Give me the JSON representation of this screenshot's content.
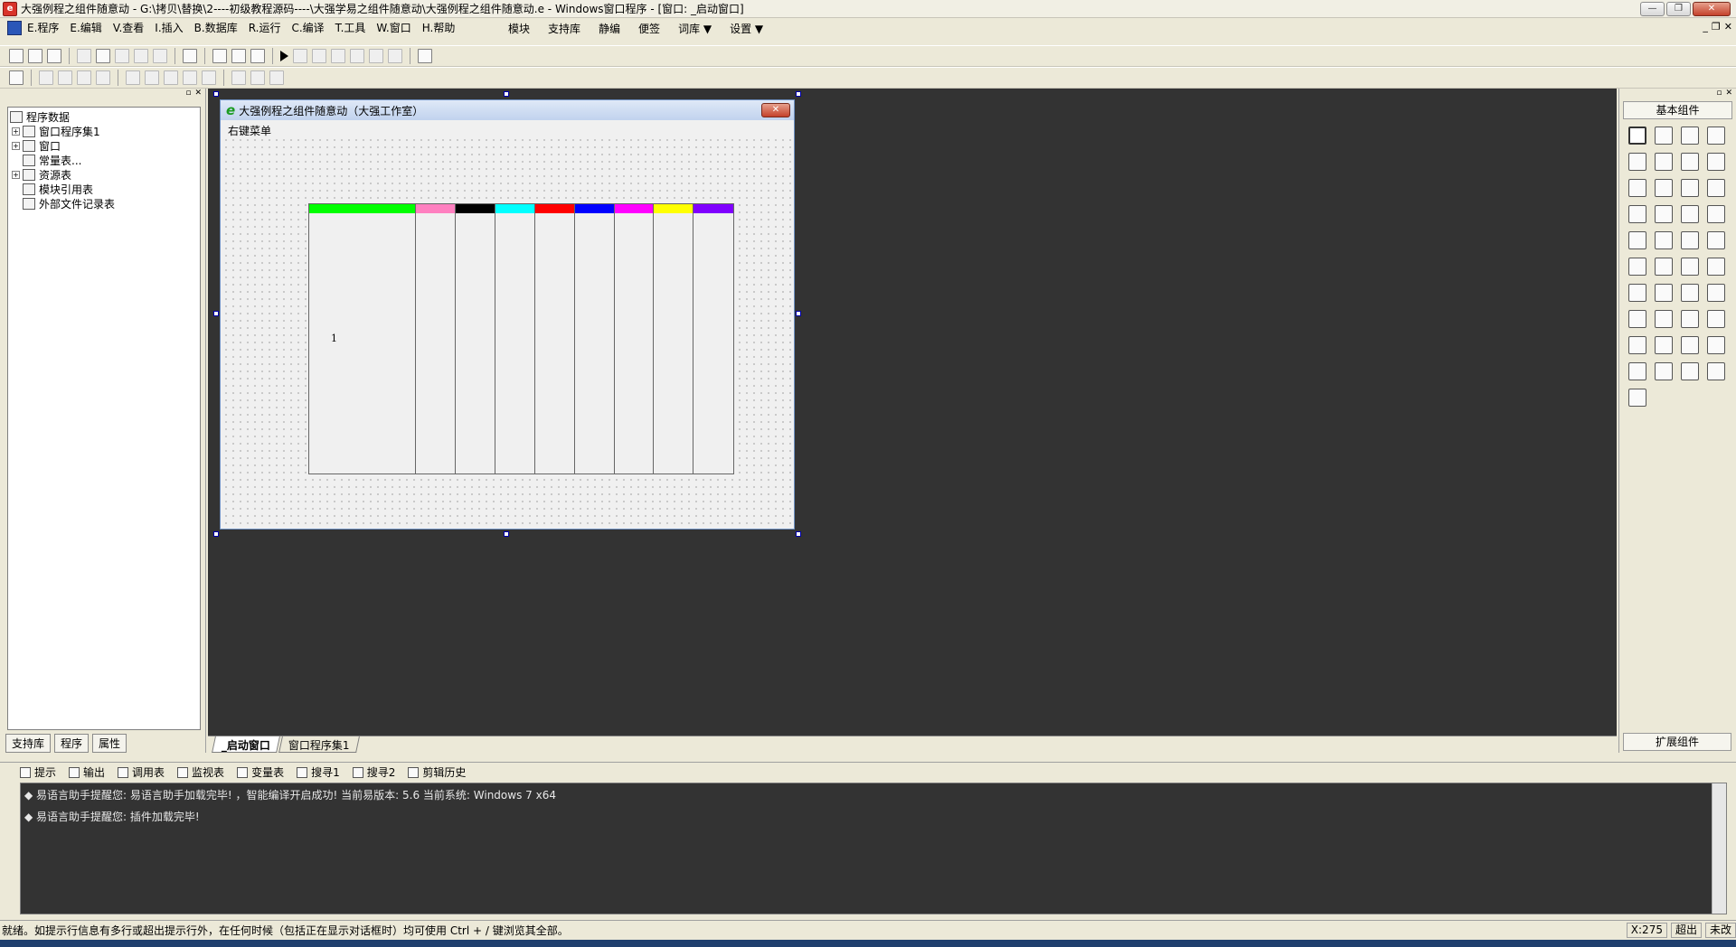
{
  "window": {
    "title": "大强例程之组件随意动 - G:\\拷贝\\替换\\2----初级教程源码----\\大强学易之组件随意动\\大强例程之组件随意动.e - Windows窗口程序 - [窗口: _启动窗口]"
  },
  "menubar": {
    "items": [
      "E.程序",
      "E.编辑",
      "V.查看",
      "I.插入",
      "B.数据库",
      "R.运行",
      "C.编译",
      "T.工具",
      "W.窗口",
      "H.帮助"
    ],
    "right_items": [
      "模块",
      "支持库",
      "静编",
      "便签",
      "词库 ▼",
      "设置 ▼"
    ]
  },
  "left_panel": {
    "tree": [
      {
        "label": "程序数据",
        "level": 0,
        "expander": ""
      },
      {
        "label": "窗口程序集1",
        "level": 1,
        "expander": "+"
      },
      {
        "label": "窗口",
        "level": 1,
        "expander": "+"
      },
      {
        "label": "常量表...",
        "level": 1,
        "expander": ""
      },
      {
        "label": "资源表",
        "level": 1,
        "expander": "+"
      },
      {
        "label": "模块引用表",
        "level": 1,
        "expander": ""
      },
      {
        "label": "外部文件记录表",
        "level": 1,
        "expander": ""
      }
    ],
    "tabs": [
      "支持库",
      "程序",
      "属性"
    ]
  },
  "designer": {
    "title": "大强例程之组件随意动（大强工作室）",
    "menu_label": "右键菜单",
    "columns": [
      {
        "color": "#00ff00",
        "label": "1"
      },
      {
        "color": "#ff80c0",
        "label": ""
      },
      {
        "color": "#000000",
        "label": ""
      },
      {
        "color": "#00ffff",
        "label": ""
      },
      {
        "color": "#ff0000",
        "label": ""
      },
      {
        "color": "#0000ff",
        "label": ""
      },
      {
        "color": "#ff00ff",
        "label": ""
      },
      {
        "color": "#ffff00",
        "label": ""
      },
      {
        "color": "#8000ff",
        "label": ""
      }
    ]
  },
  "workspace_tabs": [
    "_启动窗口",
    "窗口程序集1"
  ],
  "right_panel": {
    "title": "基本组件",
    "footer": "扩展组件"
  },
  "output": {
    "tabs": [
      "提示",
      "输出",
      "调用表",
      "监视表",
      "变量表",
      "搜寻1",
      "搜寻2",
      "剪辑历史"
    ],
    "lines": [
      "◆ 易语言助手提醒您: 易语言助手加载完毕! ，智能编译开启成功! 当前易版本: 5.6 当前系统: Windows 7 x64",
      "◆ 易语言助手提醒您: 插件加载完毕!"
    ]
  },
  "status": {
    "text": "就绪。如提示行信息有多行或超出提示行外，在任何时候（包括正在显示对话框时）均可使用 Ctrl + / 键浏览其全部。",
    "coord": "X:275",
    "mode": "超出",
    "save": "未改"
  }
}
